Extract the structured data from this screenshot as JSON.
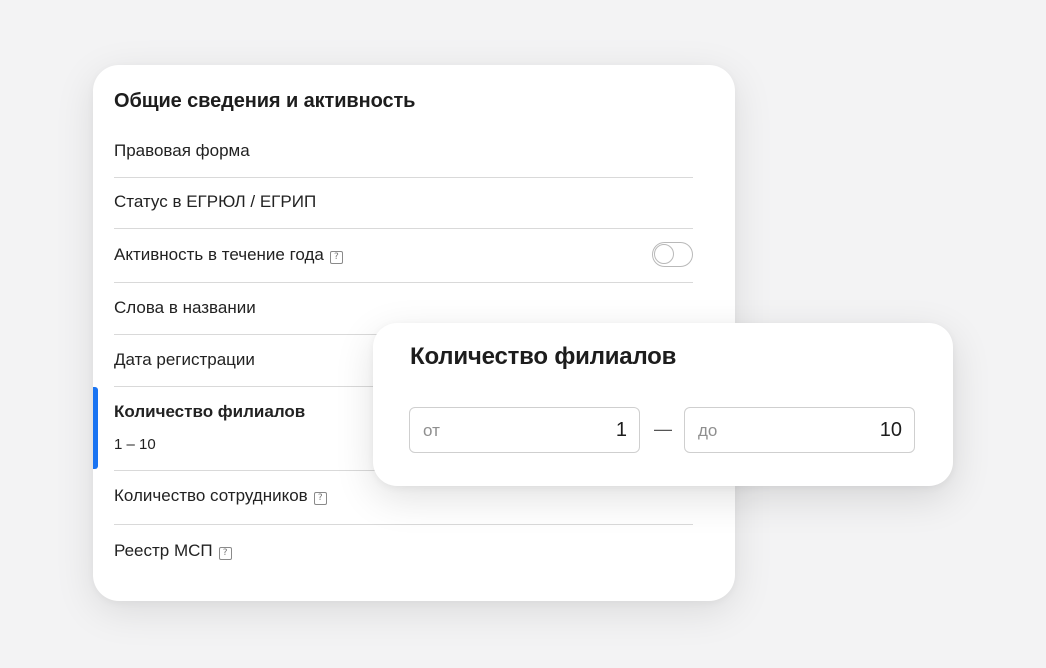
{
  "panel": {
    "title": "Общие сведения и активность",
    "rows": [
      {
        "label": "Правовая форма"
      },
      {
        "label": "Статус в ЕГРЮЛ / ЕГРИП"
      },
      {
        "label": "Активность в течение года",
        "help": "?",
        "toggle": false
      },
      {
        "label": "Слова в названии"
      },
      {
        "label": "Дата регистрации"
      },
      {
        "label": "Количество филиалов",
        "value": "1 – 10",
        "active": true
      },
      {
        "label": "Количество сотрудников",
        "help": "?"
      },
      {
        "label": "Реестр МСП",
        "help": "?"
      }
    ]
  },
  "popup": {
    "title": "Количество филиалов",
    "from": {
      "placeholder": "от",
      "value": "1"
    },
    "separator": "—",
    "to": {
      "placeholder": "до",
      "value": "10"
    }
  },
  "colors": {
    "accent": "#1a74f2",
    "background": "#f3f3f4",
    "card": "#ffffff"
  }
}
